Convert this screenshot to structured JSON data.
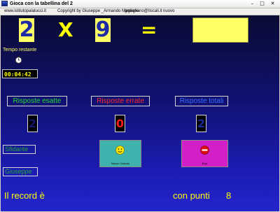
{
  "window": {
    "title": "Gioca con la tabellina del 2",
    "controls": {
      "minimize": "–",
      "maximize": "□",
      "close": "✕"
    }
  },
  "menu": {
    "items": [
      "www.istitutopalatucci.it",
      "Copyright by  Giuseppe _Armando  Magliano",
      "gmagliano@tiscali.it",
      "nuovo"
    ]
  },
  "problem": {
    "a": "2",
    "operator": "X",
    "b": "9",
    "equals": "=",
    "answer": ""
  },
  "timer": {
    "label": "Tempo restante",
    "value": "00:04:42"
  },
  "stats": {
    "correct_label": "Risposte esatte",
    "wrong_label": "Risposte errate",
    "total_label": "Risposte totali",
    "correct_value": "2",
    "wrong_value": "0",
    "total_value": "2"
  },
  "players": {
    "challenger": "Sfidante",
    "player": "Giuseppe"
  },
  "buttons": {
    "new_calc": "Nuovo Calcolo",
    "exit": "Esci"
  },
  "record": {
    "label": "Il record  è",
    "points_label": "con punti",
    "points_value": "8"
  },
  "colors": {
    "background_top": "#0b0b33",
    "background_bottom": "#2424cc",
    "number_box": "#ffff66",
    "correct": "#22d833",
    "wrong": "#ff2a2a",
    "total": "#3a6cff",
    "new_button": "#3fb2ad",
    "exit_button": "#d21fc8"
  },
  "icons": {
    "app": "app-icon",
    "clock": "stopwatch-icon",
    "new": "smiley-icon",
    "exit": "no-entry-icon"
  }
}
